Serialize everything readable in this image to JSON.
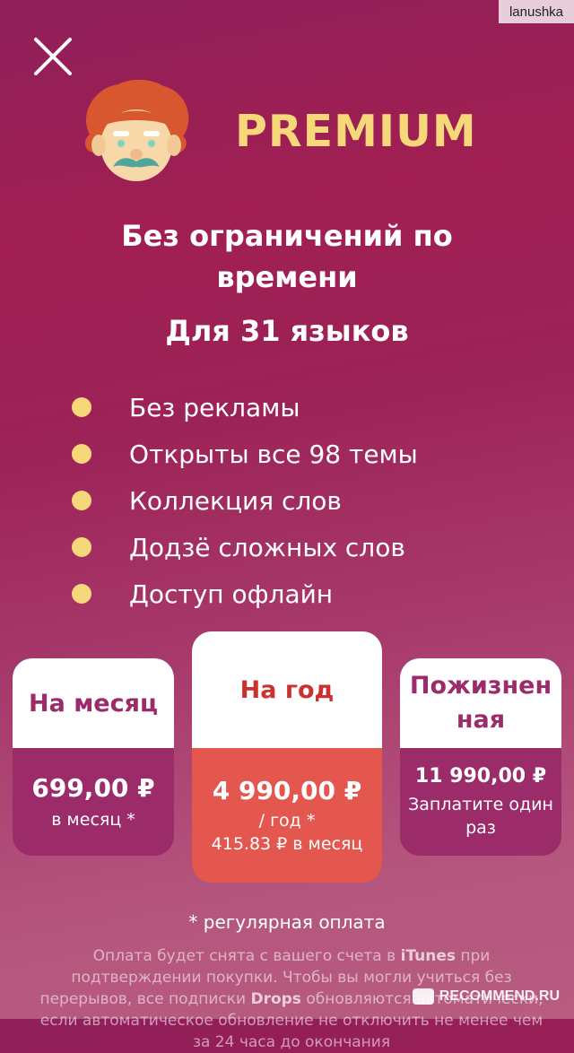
{
  "watermark_user": "lanushka",
  "icons": {
    "close": "close-icon",
    "avatar": "einstein-avatar-icon"
  },
  "header": {
    "title": "PREMIUM"
  },
  "headline": "Без ограничений по времени",
  "subheadline": "Для 31 языков",
  "features": [
    "Без рекламы",
    "Открыты все 98 темы",
    "Коллекция слов",
    "Додзё сложных слов",
    "Доступ офлайн"
  ],
  "plans": {
    "month": {
      "title": "На месяц",
      "price": "699,00 ₽",
      "note": "в месяц *"
    },
    "year": {
      "title": "На год",
      "price": "4 990,00 ₽",
      "note1": "/ год *",
      "note2": "415.83 ₽ в месяц"
    },
    "lifetime": {
      "title_line1": "Пожизнен",
      "title_line2": "ная",
      "price": "11 990,00 ₽",
      "note_line1": "Заплатите один",
      "note_line2": "раз"
    }
  },
  "footnote": "* регулярная оплата",
  "legal": {
    "p1": "Оплата будет снята с вашего счета в ",
    "itunes": "iTunes",
    "p2": " при подтверждении покупки. Чтобы вы могли учиться без перерывов, все подписки ",
    "drops": "Drops",
    "p3": " обновляются автоматически, если автоматическое обновление не отключить не менее чем за 24 часа до окончания"
  },
  "site_watermark": "RECOMMEND.RU",
  "colors": {
    "accent_yellow": "#f6d77a",
    "plan_purple": "#9c2b69",
    "plan_red": "#e3574f",
    "plan_red_text": "#c9322f"
  }
}
